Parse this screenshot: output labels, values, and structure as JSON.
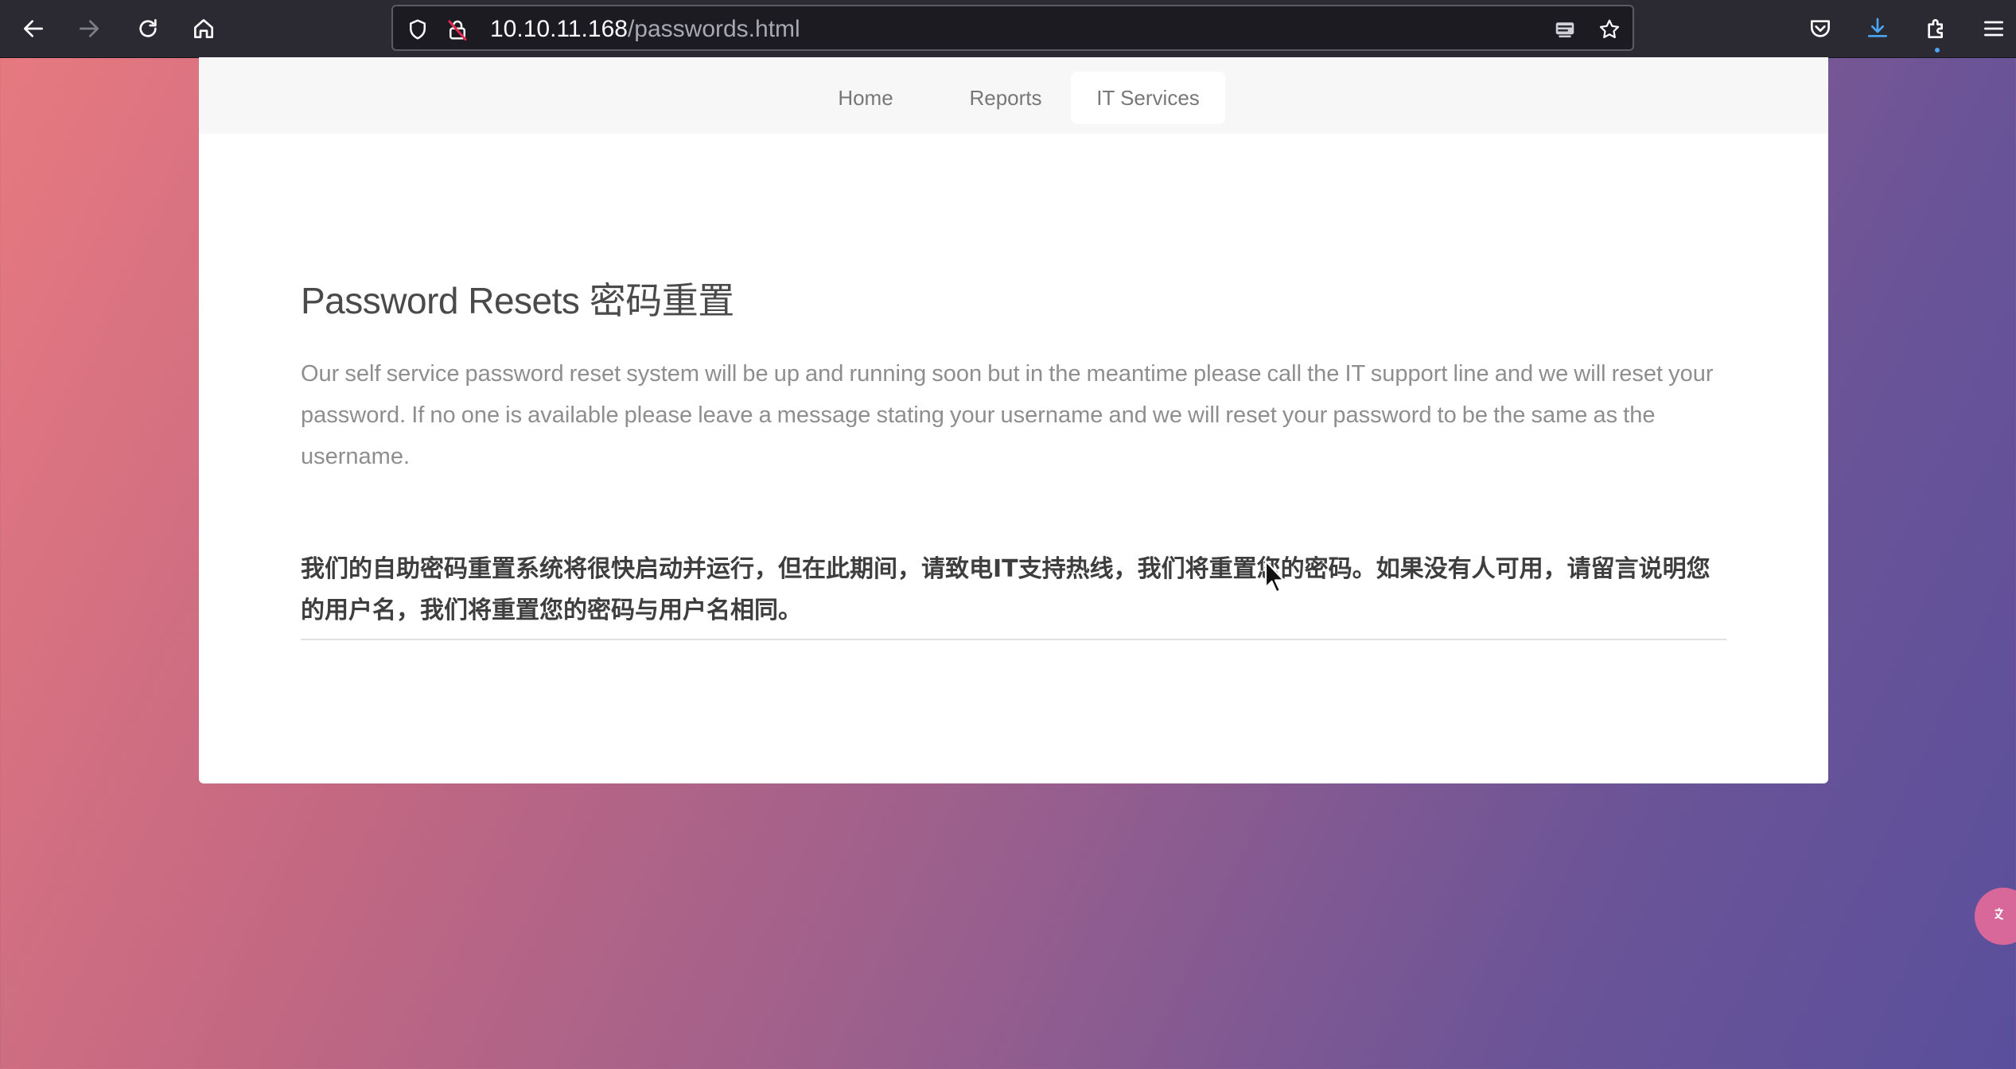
{
  "browser": {
    "url_host": "10.10.11.168",
    "url_path": "/passwords.html",
    "icons": {
      "back": "back-arrow-icon",
      "forward": "forward-arrow-icon",
      "reload": "reload-icon",
      "home": "home-icon",
      "tracking": "shield-icon",
      "security": "insecure-lock-icon",
      "reader": "reader-view-icon",
      "bookmark": "star-icon",
      "pocket": "pocket-icon",
      "downloads": "download-icon",
      "extensions": "puzzle-icon",
      "menu": "hamburger-menu-icon"
    }
  },
  "nav": {
    "items": [
      {
        "label": "Home"
      },
      {
        "label": "Reports"
      },
      {
        "label": "IT Services",
        "active": true
      }
    ]
  },
  "content": {
    "heading": "Password Resets 密码重置",
    "paragraph_en": "Our self service password reset system will be up and running soon but in the meantime please call the IT support line and we will reset your password. If no one is available please leave a message stating your username and we will reset your password to be the same as the username.",
    "paragraph_cn": "我们的自助密码重置系统将很快启动并运行，但在此期间，请致电IT支持热线，我们将重置您的密码。如果没有人可用，请留言说明您的用户名，我们将重置您的密码与用户名相同。"
  },
  "colors": {
    "chrome_bg": "#2b2a33",
    "urlbar_bg": "#1c1b22",
    "gradient_left": "#e87a80",
    "gradient_right": "#5a4f9c",
    "download_accent": "#4aa6f5"
  }
}
